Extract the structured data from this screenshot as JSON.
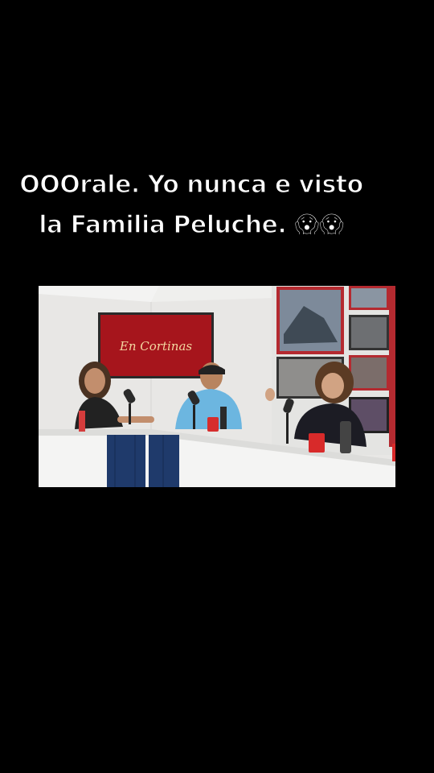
{
  "caption": {
    "line1": "OOOrale. Yo nunca e visto",
    "line2": "la Familia Peluche. 😱😱"
  },
  "video": {
    "sign_text": "En Cortinas"
  }
}
